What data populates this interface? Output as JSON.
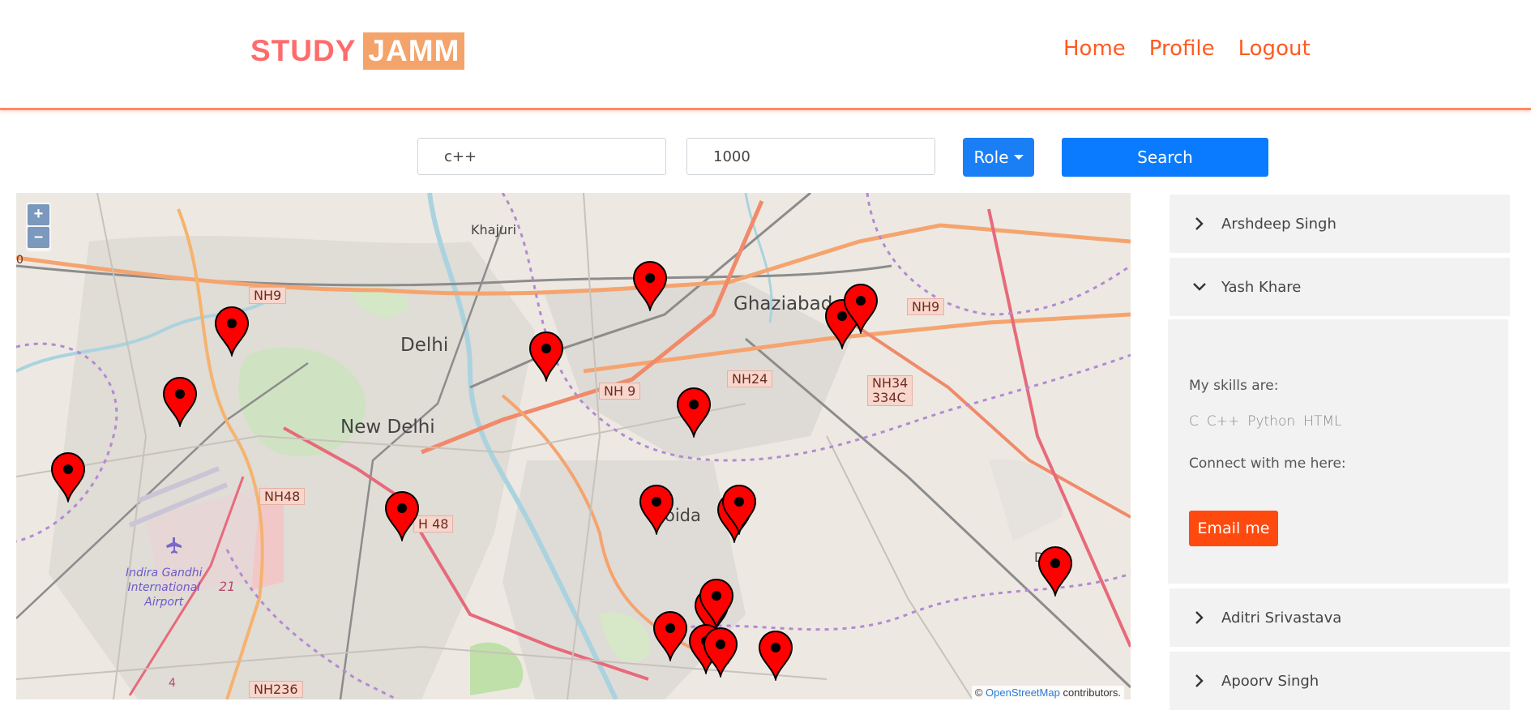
{
  "brand": {
    "part1": "STUDY",
    "part2": "JAMM"
  },
  "nav": {
    "home": "Home",
    "profile": "Profile",
    "logout": "Logout"
  },
  "search": {
    "skills_value": "c++",
    "distance_value": "1000",
    "role_label": "Role",
    "search_label": "Search"
  },
  "map": {
    "zoom_in": "+",
    "zoom_out": "–",
    "attribution_prefix": "©",
    "attribution_link": "OpenStreetMap",
    "attribution_suffix": "contributors.",
    "places": {
      "khajuri": "Khajuri",
      "delhi": "Delhi",
      "new_delhi": "New Delhi",
      "ghaziabad": "Ghaziabad",
      "noida": "oida",
      "airport": "Indira Gandhi\nInternational\nAirport",
      "dasna": "D"
    },
    "roads": {
      "nh9_west": "NH9",
      "nh9_mid": "NH 9",
      "nh9_east": "NH9",
      "nh24": "NH24",
      "nh34": "NH34\n334C",
      "nh48_west": "NH48",
      "nh48_mid": "H 48",
      "nh236": "NH236",
      "r21": "21",
      "r4": "4",
      "r0": "0"
    },
    "pin_count": 22,
    "pin_color": "#ff0000"
  },
  "sidebar": {
    "users": [
      {
        "name": "Arshdeep Singh",
        "expanded": false
      },
      {
        "name": "Yash Khare",
        "expanded": true
      },
      {
        "name": "Aditri Srivastava",
        "expanded": false
      },
      {
        "name": "Apoorv Singh",
        "expanded": false
      }
    ],
    "detail": {
      "skills_heading": "My skills are:",
      "skills": [
        "C",
        "C++",
        "Python",
        "HTML"
      ],
      "connect_text": "Connect with me here:",
      "email_label": "Email me"
    }
  },
  "colors": {
    "accent": "#ff5a1f",
    "primary": "#0a7bff",
    "header_border": "#ff8a65"
  }
}
